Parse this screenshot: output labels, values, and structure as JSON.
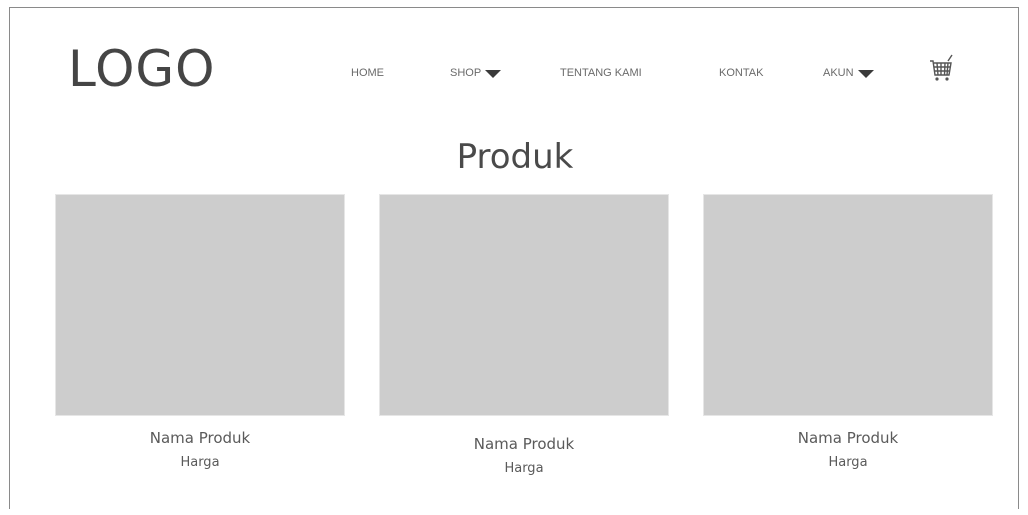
{
  "header": {
    "logo": "LOGO",
    "nav": [
      {
        "label": "HOME",
        "dropdown": false
      },
      {
        "label": "SHOP",
        "dropdown": true
      },
      {
        "label": "TENTANG KAMI",
        "dropdown": false
      },
      {
        "label": "KONTAK",
        "dropdown": false
      },
      {
        "label": "AKUN",
        "dropdown": true
      }
    ],
    "cart_icon": "cart-icon"
  },
  "main": {
    "title": "Produk",
    "products": [
      {
        "name": "Nama Produk",
        "price": "Harga"
      },
      {
        "name": "Nama Produk",
        "price": "Harga"
      },
      {
        "name": "Nama Produk",
        "price": "Harga"
      }
    ]
  },
  "colors": {
    "placeholder": "#cdcdcd",
    "text": "#4a4a4a",
    "border": "#8a8a8a"
  }
}
